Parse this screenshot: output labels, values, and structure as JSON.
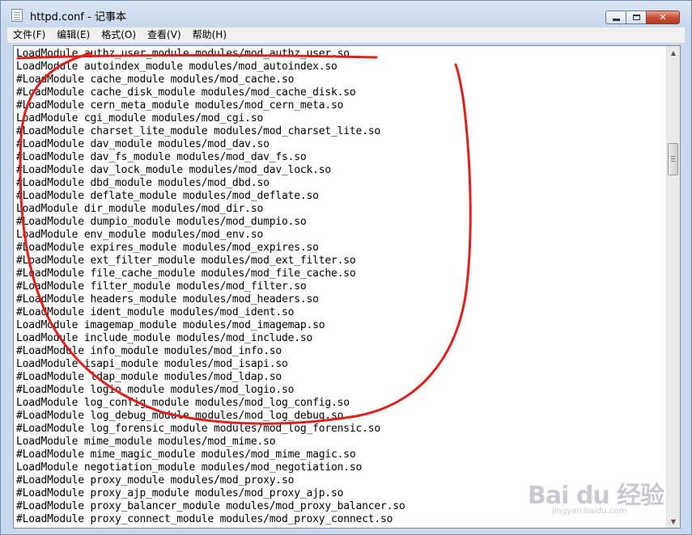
{
  "window": {
    "title": "httpd.conf - 记事本",
    "buttons": {
      "minimize": "minimize-icon",
      "maximize": "maximize-icon",
      "close": "✕"
    }
  },
  "menu": [
    {
      "label": "文件(F)"
    },
    {
      "label": "编辑(E)"
    },
    {
      "label": "格式(O)"
    },
    {
      "label": "查看(V)"
    },
    {
      "label": "帮助(H)"
    }
  ],
  "editor": {
    "lines": [
      "LoadModule authz_user_module modules/mod_authz_user.so",
      "LoadModule autoindex_module modules/mod_autoindex.so",
      "#LoadModule cache_module modules/mod_cache.so",
      "#LoadModule cache_disk_module modules/mod_cache_disk.so",
      "#LoadModule cern_meta_module modules/mod_cern_meta.so",
      "LoadModule cgi_module modules/mod_cgi.so",
      "#LoadModule charset_lite_module modules/mod_charset_lite.so",
      "#LoadModule dav_module modules/mod_dav.so",
      "#LoadModule dav_fs_module modules/mod_dav_fs.so",
      "#LoadModule dav_lock_module modules/mod_dav_lock.so",
      "#LoadModule dbd_module modules/mod_dbd.so",
      "#LoadModule deflate_module modules/mod_deflate.so",
      "LoadModule dir_module modules/mod_dir.so",
      "#LoadModule dumpio_module modules/mod_dumpio.so",
      "LoadModule env_module modules/mod_env.so",
      "#LoadModule expires_module modules/mod_expires.so",
      "#LoadModule ext_filter_module modules/mod_ext_filter.so",
      "#LoadModule file_cache_module modules/mod_file_cache.so",
      "#LoadModule filter_module modules/mod_filter.so",
      "#LoadModule headers_module modules/mod_headers.so",
      "#LoadModule ident_module modules/mod_ident.so",
      "LoadModule imagemap_module modules/mod_imagemap.so",
      "LoadModule include_module modules/mod_include.so",
      "#LoadModule info_module modules/mod_info.so",
      "LoadModule isapi_module modules/mod_isapi.so",
      "#LoadModule ldap_module modules/mod_ldap.so",
      "#LoadModule logio_module modules/mod_logio.so",
      "LoadModule log_config_module modules/mod_log_config.so",
      "#LoadModule log_debug_module modules/mod_log_debug.so",
      "#LoadModule log_forensic_module modules/mod_log_forensic.so",
      "LoadModule mime_module modules/mod_mime.so",
      "#LoadModule mime_magic_module modules/mod_mime_magic.so",
      "LoadModule negotiation_module modules/mod_negotiation.so",
      "#LoadModule proxy_module modules/mod_proxy.so",
      "#LoadModule proxy_ajp_module modules/mod_proxy_ajp.so",
      "#LoadModule proxy_balancer_module modules/mod_proxy_balancer.so",
      "#LoadModule proxy_connect_module modules/mod_proxy_connect.so"
    ]
  },
  "scrollbar": {
    "up_icon": "▲",
    "down_icon": "▼"
  },
  "annotation": {
    "color": "#e0201c"
  },
  "watermark": {
    "main": "Bai du 经验",
    "sub": "jingyan.baidu.com"
  }
}
